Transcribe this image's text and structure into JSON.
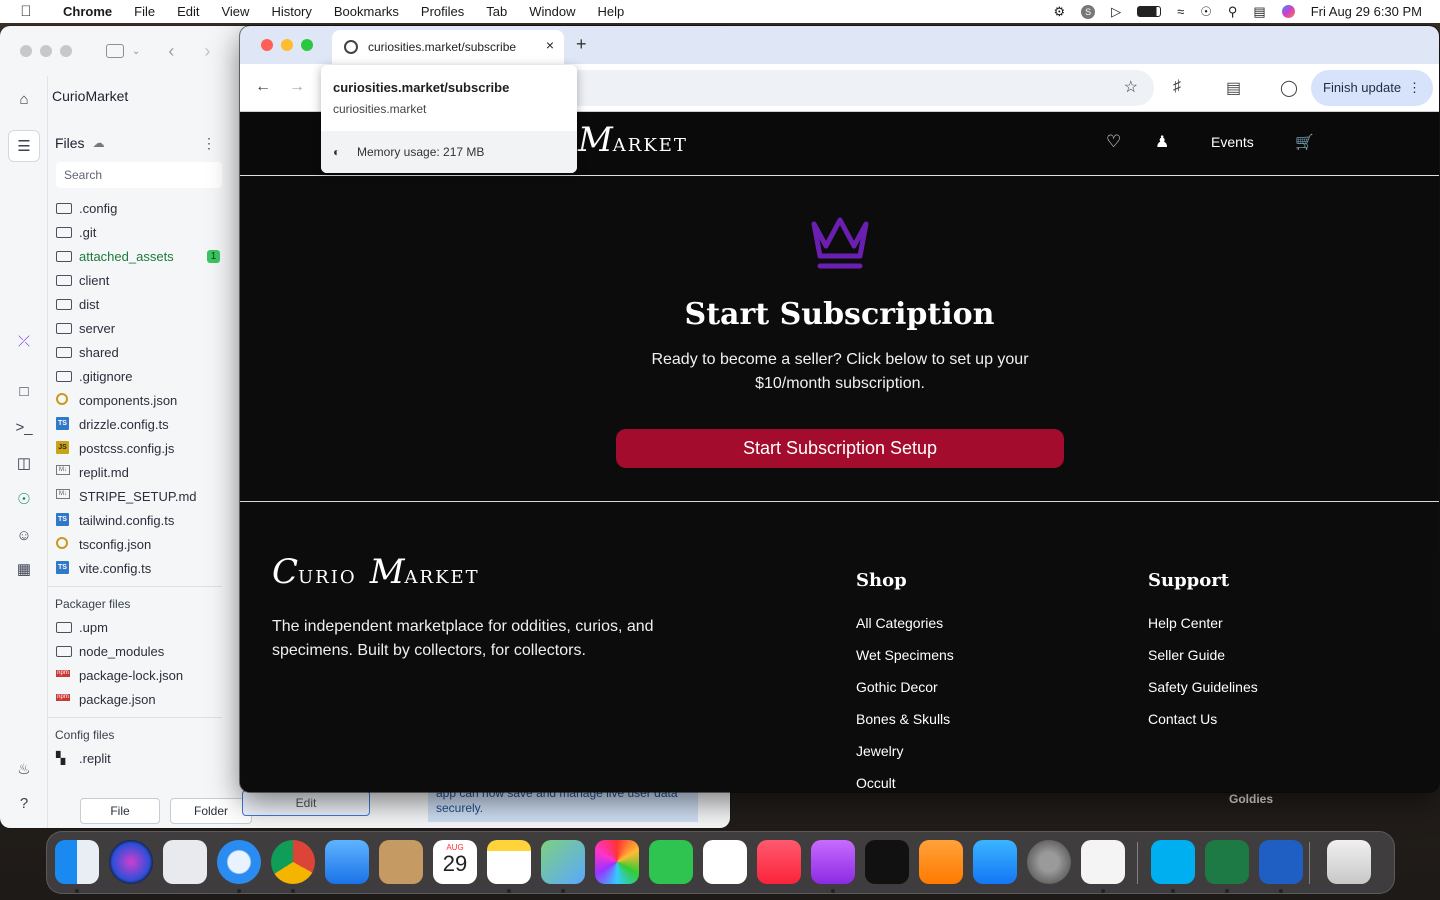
{
  "menubar": {
    "app": "Chrome",
    "items": [
      "File",
      "Edit",
      "View",
      "History",
      "Bookmarks",
      "Profiles",
      "Tab",
      "Window",
      "Help"
    ],
    "clock": "Fri Aug 29  6:30 PM"
  },
  "replit": {
    "project_name": "CurioMarket",
    "files_title": "Files",
    "search_placeholder": "Search",
    "files": [
      {
        "name": ".config",
        "icon": "folder-icon"
      },
      {
        "name": ".git",
        "icon": "folder-icon"
      },
      {
        "name": "attached_assets",
        "icon": "folder-icon",
        "badge": "1"
      },
      {
        "name": "client",
        "icon": "folder-icon"
      },
      {
        "name": "dist",
        "icon": "folder-icon"
      },
      {
        "name": "server",
        "icon": "folder-icon"
      },
      {
        "name": "shared",
        "icon": "folder-icon"
      },
      {
        "name": ".gitignore",
        "icon": "folder-icon"
      },
      {
        "name": "components.json",
        "icon": "json-icon"
      },
      {
        "name": "drizzle.config.ts",
        "icon": "ts-icon"
      },
      {
        "name": "postcss.config.js",
        "icon": "js-icon"
      },
      {
        "name": "replit.md",
        "icon": "markdown-icon"
      },
      {
        "name": "STRIPE_SETUP.md",
        "icon": "markdown-icon"
      },
      {
        "name": "tailwind.config.ts",
        "icon": "ts-icon"
      },
      {
        "name": "tsconfig.json",
        "icon": "json-icon"
      },
      {
        "name": "vite.config.ts",
        "icon": "ts-icon"
      }
    ],
    "packager_title": "Packager files",
    "packager_files": [
      {
        "name": ".upm",
        "icon": "folder-icon"
      },
      {
        "name": "node_modules",
        "icon": "folder-icon"
      },
      {
        "name": "package-lock.json",
        "icon": "npm-icon"
      },
      {
        "name": "package.json",
        "icon": "npm-icon"
      }
    ],
    "config_title": "Config files",
    "config_files": [
      {
        "name": ".replit",
        "icon": "replit-icon"
      }
    ],
    "file_button": "File",
    "folder_button": "Folder",
    "edit_label": "Edit",
    "behind_text": "app can now save and manage live user data securely."
  },
  "chrome": {
    "tab_title": "curiosities.market/subscribe",
    "url_tail": "e",
    "finish_update": "Finish update",
    "popover": {
      "url": "curiosities.market/subscribe",
      "domain": "curiosities.market",
      "memory": "Memory usage: 217 MB"
    }
  },
  "site": {
    "logo_first": "C",
    "logo_first_rest": "urio",
    "logo_second": "M",
    "logo_second_rest": "arket",
    "nav_tail": "o",
    "nav_events": "Events",
    "title": "Start Subscription",
    "text": "Ready to become a seller? Click below to set up your $10/month subscription.",
    "cta": "Start Subscription Setup",
    "footer_desc": "The independent marketplace for oddities, curios, and specimens. Built by collectors, for collectors.",
    "shop_title": "Shop",
    "shop_links": [
      "All Categories",
      "Wet Specimens",
      "Gothic Decor",
      "Bones & Skulls",
      "Jewelry",
      "Occult"
    ],
    "support_title": "Support",
    "support_links": [
      "Help Center",
      "Seller Guide",
      "Safety Guidelines",
      "Contact Us"
    ],
    "accent": "#a30c2c",
    "crown_color": "#6b1fb0"
  },
  "desktop": {
    "goldies": "Goldies"
  },
  "dock": {
    "apps": [
      "finder-icon",
      "siri-icon",
      "launchpad-icon",
      "safari-icon",
      "chrome-icon",
      "mail-icon",
      "contacts-icon",
      "calendar-icon",
      "notes-icon",
      "maps-icon",
      "photos-icon",
      "facetime-icon",
      "news-icon",
      "music-icon",
      "podcasts-icon",
      "tv-icon",
      "books-icon",
      "appstore-icon",
      "settings-icon",
      "activity-monitor-icon",
      "skype-icon",
      "excel-icon",
      "word-icon",
      "trash-icon"
    ],
    "calendar_month": "AUG",
    "calendar_day": "29"
  }
}
